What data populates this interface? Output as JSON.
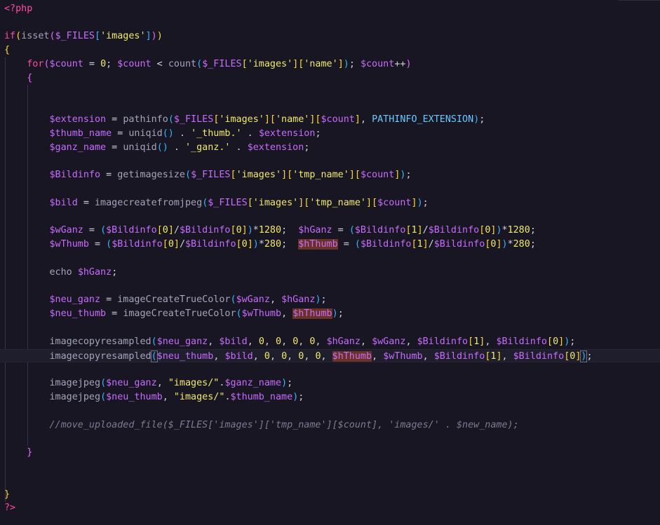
{
  "colors": {
    "background": "#171622",
    "keyword": "#ff4aa8",
    "variable": "#c96bff",
    "function": "#a4a5ba",
    "string": "#f3ea6c",
    "constant": "#6cc8ff",
    "comment": "#7d7c92",
    "highlight": "#6a3225"
  },
  "lines": [
    [
      [
        "kw",
        "<?php"
      ]
    ],
    [],
    [
      [
        "kw",
        "if"
      ],
      [
        "p1",
        "("
      ],
      [
        "fn",
        "isset"
      ],
      [
        "p2",
        "("
      ],
      [
        "var",
        "$_FILES"
      ],
      [
        "p3",
        "["
      ],
      [
        "str",
        "'images'"
      ],
      [
        "p3",
        "]"
      ],
      [
        "p2",
        ")"
      ],
      [
        "p1",
        ")"
      ]
    ],
    [
      [
        "p1",
        "{"
      ]
    ],
    [
      [
        "op",
        "    "
      ],
      [
        "kw",
        "for"
      ],
      [
        "p2",
        "("
      ],
      [
        "var",
        "$count"
      ],
      [
        "op",
        " = "
      ],
      [
        "num",
        "0"
      ],
      [
        "op",
        "; "
      ],
      [
        "var",
        "$count"
      ],
      [
        "op",
        " < "
      ],
      [
        "fn",
        "count"
      ],
      [
        "p3",
        "("
      ],
      [
        "var",
        "$_FILES"
      ],
      [
        "p1",
        "["
      ],
      [
        "str",
        "'images'"
      ],
      [
        "p1",
        "]["
      ],
      [
        "str",
        "'name'"
      ],
      [
        "p1",
        "]"
      ],
      [
        "p3",
        ")"
      ],
      [
        "op",
        "; "
      ],
      [
        "var",
        "$count"
      ],
      [
        "op",
        "++"
      ],
      [
        "p2",
        ")"
      ]
    ],
    [
      [
        "op",
        "    "
      ],
      [
        "p2",
        "{"
      ]
    ],
    [],
    [],
    [
      [
        "op",
        "        "
      ],
      [
        "var",
        "$extension"
      ],
      [
        "op",
        " = "
      ],
      [
        "fn",
        "pathinfo"
      ],
      [
        "p3",
        "("
      ],
      [
        "var",
        "$_FILES"
      ],
      [
        "p1",
        "["
      ],
      [
        "str",
        "'images'"
      ],
      [
        "p1",
        "]["
      ],
      [
        "str",
        "'name'"
      ],
      [
        "p1",
        "]["
      ],
      [
        "var",
        "$count"
      ],
      [
        "p1",
        "]"
      ],
      [
        "op",
        ", "
      ],
      [
        "const",
        "PATHINFO_EXTENSION"
      ],
      [
        "p3",
        ")"
      ],
      [
        "op",
        ";"
      ]
    ],
    [
      [
        "op",
        "        "
      ],
      [
        "var",
        "$thumb_name"
      ],
      [
        "op",
        " = "
      ],
      [
        "fn",
        "uniqid"
      ],
      [
        "p3",
        "()"
      ],
      [
        "op",
        " . "
      ],
      [
        "str",
        "'_thumb.'"
      ],
      [
        "op",
        " . "
      ],
      [
        "var",
        "$extension"
      ],
      [
        "op",
        ";"
      ]
    ],
    [
      [
        "op",
        "        "
      ],
      [
        "var",
        "$ganz_name"
      ],
      [
        "op",
        " = "
      ],
      [
        "fn",
        "uniqid"
      ],
      [
        "p3",
        "()"
      ],
      [
        "op",
        " . "
      ],
      [
        "str",
        "'_ganz.'"
      ],
      [
        "op",
        " . "
      ],
      [
        "var",
        "$extension"
      ],
      [
        "op",
        ";"
      ]
    ],
    [],
    [
      [
        "op",
        "        "
      ],
      [
        "var",
        "$Bildinfo"
      ],
      [
        "op",
        " = "
      ],
      [
        "fn",
        "getimagesize"
      ],
      [
        "p3",
        "("
      ],
      [
        "var",
        "$_FILES"
      ],
      [
        "p1",
        "["
      ],
      [
        "str",
        "'images'"
      ],
      [
        "p1",
        "]["
      ],
      [
        "str",
        "'tmp_name'"
      ],
      [
        "p1",
        "]["
      ],
      [
        "var",
        "$count"
      ],
      [
        "p1",
        "]"
      ],
      [
        "p3",
        ")"
      ],
      [
        "op",
        ";"
      ]
    ],
    [],
    [
      [
        "op",
        "        "
      ],
      [
        "var",
        "$bild"
      ],
      [
        "op",
        " = "
      ],
      [
        "fn",
        "imagecreatefromjpeg"
      ],
      [
        "p3",
        "("
      ],
      [
        "var",
        "$_FILES"
      ],
      [
        "p1",
        "["
      ],
      [
        "str",
        "'images'"
      ],
      [
        "p1",
        "]["
      ],
      [
        "str",
        "'tmp_name'"
      ],
      [
        "p1",
        "]["
      ],
      [
        "var",
        "$count"
      ],
      [
        "p1",
        "]"
      ],
      [
        "p3",
        ")"
      ],
      [
        "op",
        ";"
      ]
    ],
    [],
    [
      [
        "op",
        "        "
      ],
      [
        "var",
        "$wGanz"
      ],
      [
        "op",
        " = "
      ],
      [
        "p3",
        "("
      ],
      [
        "var",
        "$Bildinfo"
      ],
      [
        "p1",
        "["
      ],
      [
        "num",
        "0"
      ],
      [
        "p1",
        "]"
      ],
      [
        "op",
        "/"
      ],
      [
        "var",
        "$Bildinfo"
      ],
      [
        "p1",
        "["
      ],
      [
        "num",
        "0"
      ],
      [
        "p1",
        "]"
      ],
      [
        "p3",
        ")"
      ],
      [
        "op",
        "*"
      ],
      [
        "num",
        "1280"
      ],
      [
        "op",
        ";  "
      ],
      [
        "var",
        "$hGanz"
      ],
      [
        "op",
        " = "
      ],
      [
        "p3",
        "("
      ],
      [
        "var",
        "$Bildinfo"
      ],
      [
        "p1",
        "["
      ],
      [
        "num",
        "1"
      ],
      [
        "p1",
        "]"
      ],
      [
        "op",
        "/"
      ],
      [
        "var",
        "$Bildinfo"
      ],
      [
        "p1",
        "["
      ],
      [
        "num",
        "0"
      ],
      [
        "p1",
        "]"
      ],
      [
        "p3",
        ")"
      ],
      [
        "op",
        "*"
      ],
      [
        "num",
        "1280"
      ],
      [
        "op",
        ";"
      ]
    ],
    [
      [
        "op",
        "        "
      ],
      [
        "var",
        "$wThumb"
      ],
      [
        "op",
        " = "
      ],
      [
        "p3",
        "("
      ],
      [
        "var",
        "$Bildinfo"
      ],
      [
        "p1",
        "["
      ],
      [
        "num",
        "0"
      ],
      [
        "p1",
        "]"
      ],
      [
        "op",
        "/"
      ],
      [
        "var",
        "$Bildinfo"
      ],
      [
        "p1",
        "["
      ],
      [
        "num",
        "0"
      ],
      [
        "p1",
        "]"
      ],
      [
        "p3",
        ")"
      ],
      [
        "op",
        "*"
      ],
      [
        "num",
        "280"
      ],
      [
        "op",
        ";  "
      ],
      [
        "var hl",
        "$hThumb"
      ],
      [
        "op",
        " = "
      ],
      [
        "p3",
        "("
      ],
      [
        "var",
        "$Bildinfo"
      ],
      [
        "p1",
        "["
      ],
      [
        "num",
        "1"
      ],
      [
        "p1",
        "]"
      ],
      [
        "op",
        "/"
      ],
      [
        "var",
        "$Bildinfo"
      ],
      [
        "p1",
        "["
      ],
      [
        "num",
        "0"
      ],
      [
        "p1",
        "]"
      ],
      [
        "p3",
        ")"
      ],
      [
        "op",
        "*"
      ],
      [
        "num",
        "280"
      ],
      [
        "op",
        ";"
      ]
    ],
    [],
    [
      [
        "op",
        "        "
      ],
      [
        "fn",
        "echo"
      ],
      [
        "op",
        " "
      ],
      [
        "var",
        "$hGanz"
      ],
      [
        "op",
        ";"
      ]
    ],
    [],
    [
      [
        "op",
        "        "
      ],
      [
        "var",
        "$neu_ganz"
      ],
      [
        "op",
        " = "
      ],
      [
        "fn",
        "imageCreateTrueColor"
      ],
      [
        "p3",
        "("
      ],
      [
        "var",
        "$wGanz"
      ],
      [
        "op",
        ", "
      ],
      [
        "var",
        "$hGanz"
      ],
      [
        "p3",
        ")"
      ],
      [
        "op",
        ";"
      ]
    ],
    [
      [
        "op",
        "        "
      ],
      [
        "var",
        "$neu_thumb"
      ],
      [
        "op",
        " = "
      ],
      [
        "fn",
        "imageCreateTrueColor"
      ],
      [
        "p3",
        "("
      ],
      [
        "var",
        "$wThumb"
      ],
      [
        "op",
        ", "
      ],
      [
        "var hl",
        "$hThumb"
      ],
      [
        "p3",
        ")"
      ],
      [
        "op",
        ";"
      ]
    ],
    [],
    [
      [
        "op",
        "        "
      ],
      [
        "fn",
        "imagecopyresampled"
      ],
      [
        "p3",
        "("
      ],
      [
        "var",
        "$neu_ganz"
      ],
      [
        "op",
        ", "
      ],
      [
        "var",
        "$bild"
      ],
      [
        "op",
        ", "
      ],
      [
        "num",
        "0"
      ],
      [
        "op",
        ", "
      ],
      [
        "num",
        "0"
      ],
      [
        "op",
        ", "
      ],
      [
        "num",
        "0"
      ],
      [
        "op",
        ", "
      ],
      [
        "num",
        "0"
      ],
      [
        "op",
        ", "
      ],
      [
        "var",
        "$hGanz"
      ],
      [
        "op",
        ", "
      ],
      [
        "var",
        "$wGanz"
      ],
      [
        "op",
        ", "
      ],
      [
        "var",
        "$Bildinfo"
      ],
      [
        "p1",
        "["
      ],
      [
        "num",
        "1"
      ],
      [
        "p1",
        "]"
      ],
      [
        "op",
        ", "
      ],
      [
        "var",
        "$Bildinfo"
      ],
      [
        "p1",
        "["
      ],
      [
        "num",
        "0"
      ],
      [
        "p1",
        "]"
      ],
      [
        "p3",
        ")"
      ],
      [
        "op",
        ";"
      ]
    ],
    [
      [
        "op",
        "        "
      ],
      [
        "fn",
        "imagecopyresampled"
      ],
      [
        "p3 bm",
        "("
      ],
      [
        "var",
        "$neu_thumb"
      ],
      [
        "op",
        ", "
      ],
      [
        "var",
        "$bild"
      ],
      [
        "op",
        ", "
      ],
      [
        "num",
        "0"
      ],
      [
        "op",
        ", "
      ],
      [
        "num",
        "0"
      ],
      [
        "op",
        ", "
      ],
      [
        "num",
        "0"
      ],
      [
        "op",
        ", "
      ],
      [
        "num",
        "0"
      ],
      [
        "op",
        ", "
      ],
      [
        "var hl",
        "$hThumb"
      ],
      [
        "op",
        ", "
      ],
      [
        "var",
        "$wThumb"
      ],
      [
        "op",
        ", "
      ],
      [
        "var",
        "$Bildinfo"
      ],
      [
        "p1",
        "["
      ],
      [
        "num",
        "1"
      ],
      [
        "p1",
        "]"
      ],
      [
        "op",
        ", "
      ],
      [
        "var",
        "$Bildinfo"
      ],
      [
        "p1",
        "["
      ],
      [
        "num",
        "0"
      ],
      [
        "p1",
        "]"
      ],
      [
        "p3 bm",
        ")"
      ],
      [
        "op",
        ";"
      ]
    ],
    [],
    [
      [
        "op",
        "        "
      ],
      [
        "fn",
        "imagejpeg"
      ],
      [
        "p3",
        "("
      ],
      [
        "var",
        "$neu_ganz"
      ],
      [
        "op",
        ", "
      ],
      [
        "str",
        "\"images/\""
      ],
      [
        "op",
        "."
      ],
      [
        "var",
        "$ganz_name"
      ],
      [
        "p3",
        ")"
      ],
      [
        "op",
        ";"
      ]
    ],
    [
      [
        "op",
        "        "
      ],
      [
        "fn",
        "imagejpeg"
      ],
      [
        "p3",
        "("
      ],
      [
        "var",
        "$neu_thumb"
      ],
      [
        "op",
        ", "
      ],
      [
        "str",
        "\"images/\""
      ],
      [
        "op",
        "."
      ],
      [
        "var",
        "$thumb_name"
      ],
      [
        "p3",
        ")"
      ],
      [
        "op",
        ";"
      ]
    ],
    [],
    [
      [
        "op",
        "        "
      ],
      [
        "cm",
        "//move_uploaded_file($_FILES['images']['tmp_name'][$count], 'images/' . $new_name);"
      ]
    ],
    [],
    [
      [
        "op",
        "    "
      ],
      [
        "p2",
        "}"
      ]
    ],
    [],
    [],
    [
      [
        "p1",
        "}"
      ]
    ],
    [
      [
        "kw",
        "?>"
      ]
    ]
  ]
}
